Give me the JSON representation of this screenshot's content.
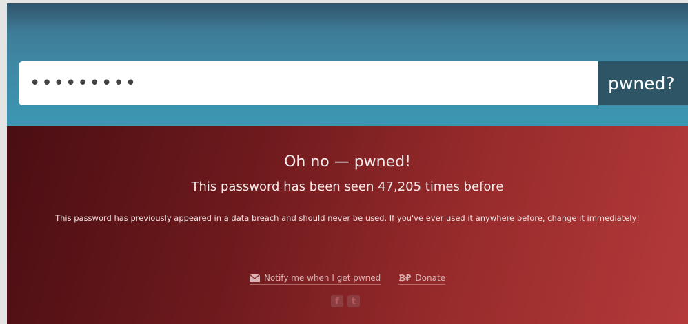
{
  "search": {
    "value": "•••••••••",
    "button_label": "pwned?"
  },
  "result": {
    "title": "Oh no — pwned!",
    "subtitle": "This password has been seen 47,205 times before",
    "message": "This password has previously appeared in a data breach and should never be used. If you've ever used it anywhere before, change it immediately!"
  },
  "actions": {
    "notify_label": "Notify me when I get pwned",
    "donate_label": "Donate",
    "donate_icon_text": "₿₽"
  },
  "social": {
    "facebook_glyph": "f",
    "twitter_glyph": "t"
  },
  "colors": {
    "top_band": "#3e87a3",
    "button": "#2e5566",
    "alert": "#962a2b"
  }
}
